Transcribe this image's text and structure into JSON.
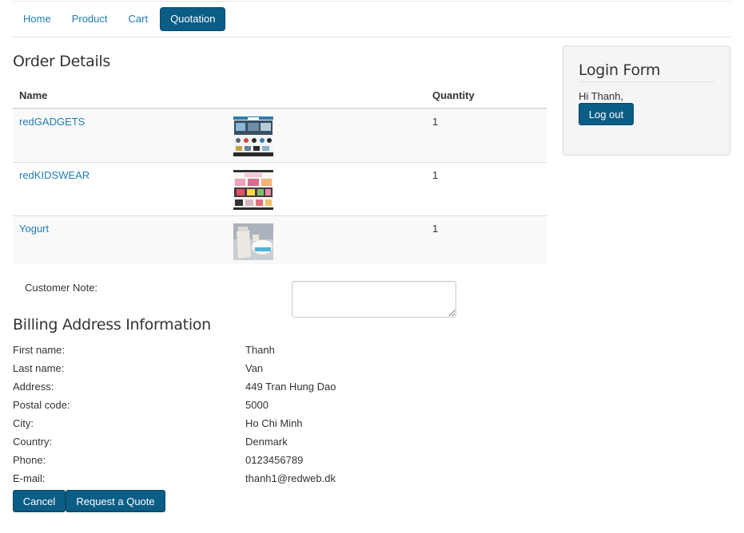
{
  "nav": {
    "items": [
      {
        "label": "Home",
        "active": false
      },
      {
        "label": "Product",
        "active": false
      },
      {
        "label": "Cart",
        "active": false
      },
      {
        "label": "Quotation",
        "active": true
      }
    ]
  },
  "order": {
    "title": "Order Details",
    "columns": {
      "name": "Name",
      "quantity": "Quantity"
    },
    "rows": [
      {
        "name": "redGADGETS",
        "image": "redgadgets-thumbnail",
        "quantity": "1"
      },
      {
        "name": "redKIDSWEAR",
        "image": "redkidswear-thumbnail",
        "quantity": "1"
      },
      {
        "name": "Yogurt",
        "image": "yogurt-thumbnail",
        "quantity": "1"
      }
    ]
  },
  "note": {
    "label": "Customer Note:",
    "value": ""
  },
  "billing": {
    "title": "Billing Address Information",
    "fields": [
      {
        "label": "First name:",
        "value": "Thanh"
      },
      {
        "label": "Last name:",
        "value": "Van"
      },
      {
        "label": "Address:",
        "value": "449 Tran Hung Dao"
      },
      {
        "label": "Postal code:",
        "value": "5000"
      },
      {
        "label": "City:",
        "value": "Ho Chi Minh"
      },
      {
        "label": "Country:",
        "value": "Denmark"
      },
      {
        "label": "Phone:",
        "value": "0123456789"
      },
      {
        "label": "E-mail:",
        "value": "thanh1@redweb.dk"
      }
    ]
  },
  "actions": {
    "cancel": "Cancel",
    "quote": "Request a Quote"
  },
  "login": {
    "title": "Login Form",
    "greeting": "Hi Thanh,",
    "logout": "Log out"
  },
  "colors": {
    "primary": "#0a5d85",
    "link": "#1f7db4",
    "panel": "#f5f5f5"
  }
}
